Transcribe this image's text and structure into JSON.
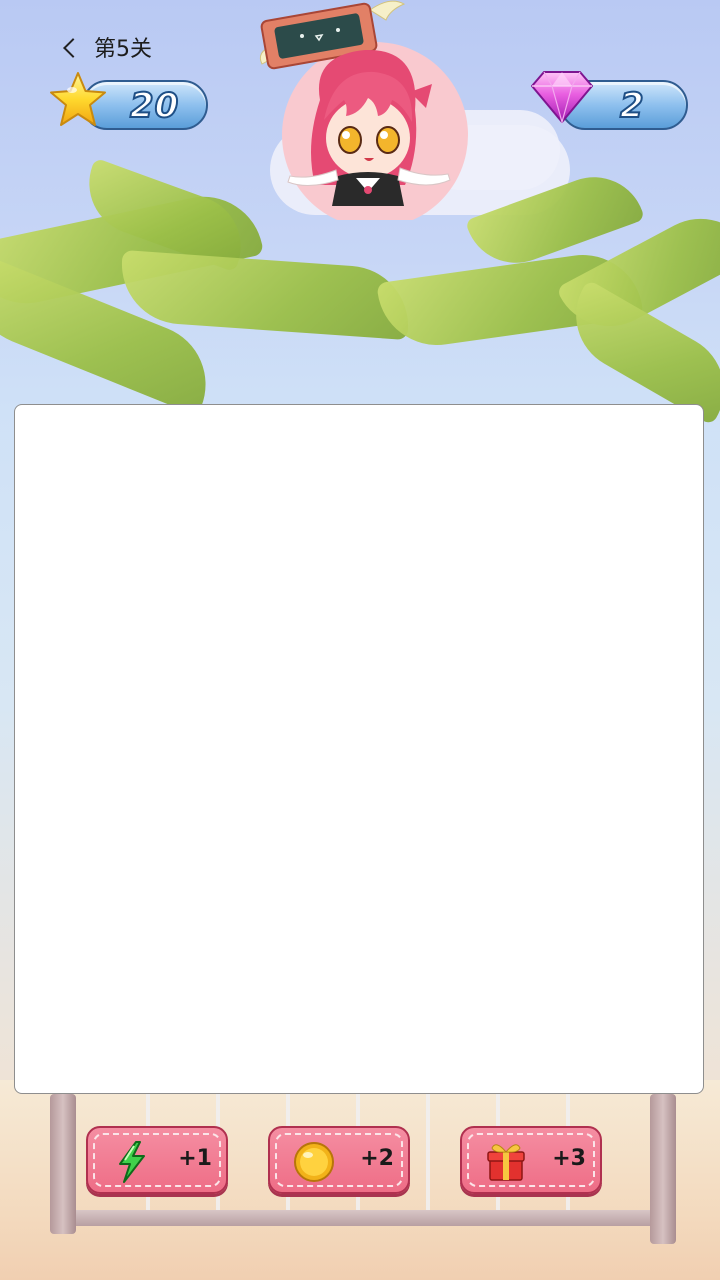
{
  "header": {
    "level_label": "第5关"
  },
  "counters": {
    "stars": "20",
    "gems": "2"
  },
  "powerups": [
    {
      "icon": "lightning-icon",
      "count": "+1"
    },
    {
      "icon": "coin-icon",
      "count": "+2"
    },
    {
      "icon": "gift-box-icon",
      "count": "+3"
    }
  ],
  "colors": {
    "powerup_bg": "#f0758d",
    "counter_bg": "#8ec0ee",
    "board_bg": "#ffffff"
  }
}
